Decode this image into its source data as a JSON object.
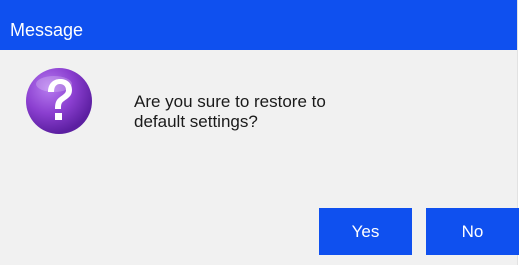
{
  "dialog": {
    "title": "Message",
    "icon": "question-icon",
    "message_line1": "Are you sure to restore to",
    "message_line2": "default settings?",
    "yes_label": "Yes",
    "no_label": "No"
  },
  "colors": {
    "titlebar": "#0f50ef",
    "button": "#0f50ef",
    "icon": "#8b3fd0",
    "dialog_background": "#f1f1f1"
  }
}
